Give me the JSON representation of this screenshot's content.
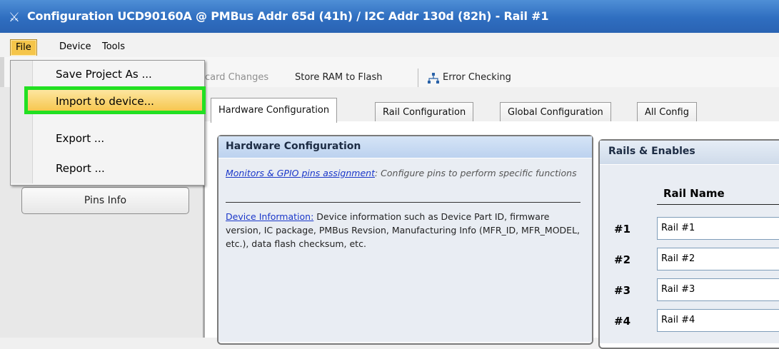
{
  "window": {
    "title": "Configuration UCD90160A @ PMBus Addr 65d (41h) / I2C Addr 130d (82h)  - Rail #1",
    "icon": "ti-logo-icon"
  },
  "menubar": {
    "items": [
      {
        "label": "File",
        "active": true
      },
      {
        "label": "Device"
      },
      {
        "label": "Tools"
      }
    ]
  },
  "file_menu": {
    "items": [
      {
        "label": "Save Project As ..."
      },
      {
        "label": "Import to device...",
        "highlighted": true
      },
      {
        "label": "Export ..."
      },
      {
        "label": "Report ..."
      }
    ],
    "highlight_color": "#22e022"
  },
  "toolbar": {
    "discard_label": "card Changes",
    "store_label": "Store RAM to Flash",
    "error_checking_label": "Error Checking",
    "error_checking_icon": "network-icon"
  },
  "left_panel": {
    "pins_info_label": "Pins Info"
  },
  "tabs": [
    {
      "label": "Hardware Configuration",
      "active": true
    },
    {
      "label": "Rail Configuration"
    },
    {
      "label": "Global Configuration"
    },
    {
      "label": "All Config"
    }
  ],
  "hardware_panel": {
    "title": "Hardware Configuration",
    "monitors_link": "Monitors & GPIO pins assignment",
    "monitors_desc": ": Configure pins to perform specific functions",
    "device_info_link": "Device Information:",
    "device_info_desc": " Device information such as Device Part ID, firmware version, IC package, PMBus Revsion, Manufacturing Info (MFR_ID, MFR_MODEL, etc.), data flash checksum, etc."
  },
  "rails_panel": {
    "title": "Rails & Enables",
    "column_header": "Rail Name",
    "rails": [
      {
        "num": "#1",
        "name": "Rail #1"
      },
      {
        "num": "#2",
        "name": "Rail #2"
      },
      {
        "num": "#3",
        "name": "Rail #3"
      },
      {
        "num": "#4",
        "name": "Rail #4"
      }
    ]
  }
}
